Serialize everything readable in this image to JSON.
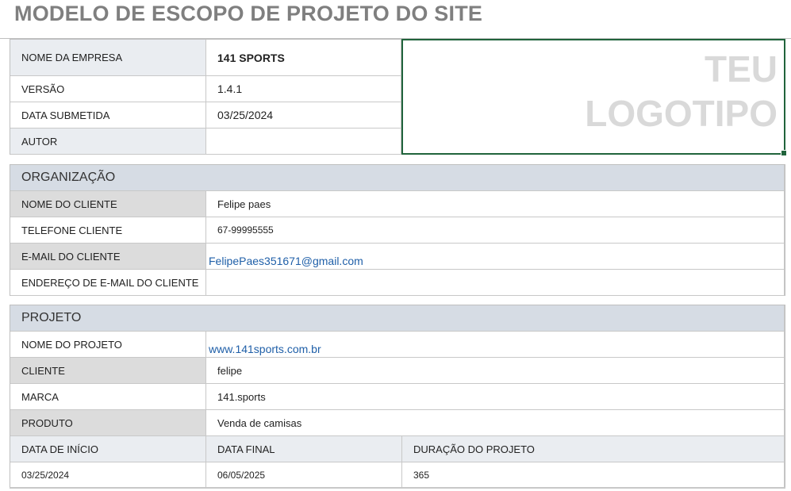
{
  "title": "MODELO DE ESCOPO DE PROJETO DO SITE",
  "logo": {
    "line1": "TEU",
    "line2": "LOGOTIPO"
  },
  "company": {
    "name_label": "NOME DA EMPRESA",
    "name_value": "141 SPORTS",
    "version_label": "VERSÃO",
    "version_value": "1.4.1",
    "submitted_label": "DATA SUBMETIDA",
    "submitted_value": "03/25/2024",
    "author_label": "AUTOR",
    "author_value": ""
  },
  "organization": {
    "header": "ORGANIZAÇÃO",
    "client_name_label": "NOME DO CLIENTE",
    "client_name_value": "Felipe paes",
    "phone_label": "TELEFONE CLIENTE",
    "phone_value": "67-99995555",
    "email_label": "E-MAIL DO CLIENTE",
    "email_value": "FelipePaes351671@gmail.com",
    "email_address_label": "ENDEREÇO DE E-MAIL DO CLIENTE",
    "email_address_value": ""
  },
  "project": {
    "header": "PROJETO",
    "name_label": "NOME DO PROJETO",
    "name_value": "www.141sports.com.br",
    "client_label": "CLIENTE",
    "client_value": "felipe",
    "brand_label": "MARCA",
    "brand_value": "141.sports",
    "product_label": "PRODUTO",
    "product_value": "Venda de camisas",
    "start_label": "DATA DE INÍCIO",
    "start_value": "03/25/2024",
    "end_label": "DATA FINAL",
    "end_value": "06/05/2025",
    "duration_label": "DURAÇÃO DO PROJETO",
    "duration_value": "365"
  },
  "colors": {
    "link": "#1f5fa8",
    "selection_border": "#21643c",
    "header_bg": "#d6dce4"
  }
}
